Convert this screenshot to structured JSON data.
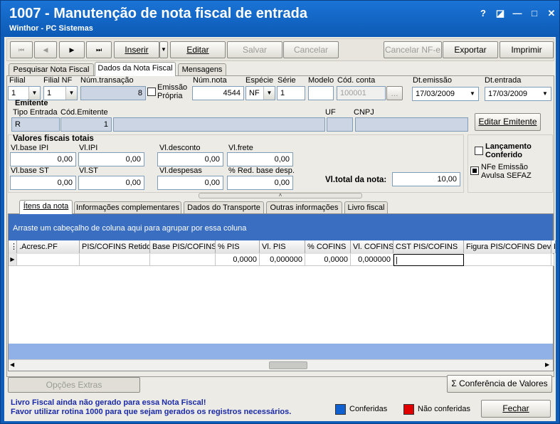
{
  "window": {
    "title": "1007 - Manutenção de nota fiscal de entrada",
    "subtitle": "Winthor - PC Sistemas",
    "help": "?",
    "restore": "◪",
    "min": "—",
    "max": "□",
    "close": "✕"
  },
  "toolbar": {
    "first": "⏮",
    "prev": "◀",
    "next": "▶",
    "last": "⏭",
    "inserir": "Inserir",
    "inserir_arrow": "▼",
    "editar": "Editar",
    "salvar": "Salvar",
    "cancelar": "Cancelar",
    "cancelar_nfe": "Cancelar NF-e",
    "exportar": "Exportar",
    "imprimir": "Imprimir"
  },
  "tabs": [
    "Pesquisar Nota Fiscal",
    "Dados da Nota Fiscal",
    "Mensagens"
  ],
  "form": {
    "filial": {
      "label": "Filial",
      "value": "1"
    },
    "filial_nf": {
      "label": "Filial NF",
      "value": "1"
    },
    "num_transacao": {
      "label": "Núm.transação",
      "value": "8"
    },
    "emissao_propria": {
      "label1": "Emissão",
      "label2": "Própria"
    },
    "num_nota": {
      "label": "Núm.nota",
      "value": "4544"
    },
    "especie": {
      "label": "Espécie",
      "value": "NF"
    },
    "serie": {
      "label": "Série",
      "value": "1"
    },
    "modelo": {
      "label": "Modelo",
      "value": ""
    },
    "cod_conta": {
      "label": "Cód. conta",
      "value": "100001",
      "btn": "..."
    },
    "dt_emissao": {
      "label": "Dt.emissão",
      "value": "17/03/2009"
    },
    "dt_entrada": {
      "label": "Dt.entrada",
      "value": "17/03/2009"
    }
  },
  "emitente": {
    "title": "Emitente",
    "tipo_label": "Tipo Entrada",
    "tipo_value": "R",
    "cod_label": "Cód.Emitente",
    "cod_value": "1",
    "uf_label": "UF",
    "cnpj_label": "CNPJ",
    "editar_btn": "Editar Emitente"
  },
  "valores": {
    "title": "Valores fiscais totais",
    "base_ipi": {
      "label": "Vl.base IPI",
      "value": "0,00"
    },
    "ipi": {
      "label": "Vl.IPI",
      "value": "0,00"
    },
    "desconto": {
      "label": "Vl.desconto",
      "value": "0,00"
    },
    "frete": {
      "label": "Vl.frete",
      "value": "0,00"
    },
    "base_st": {
      "label": "Vl.base ST",
      "value": "0,00"
    },
    "st": {
      "label": "Vl.ST",
      "value": "0,00"
    },
    "despesas": {
      "label": "Vl.despesas",
      "value": "0,00"
    },
    "red_base": {
      "label": "% Red. base desp.",
      "value": "0,00"
    },
    "total": {
      "label": "Vl.total da nota:",
      "value": "10,00"
    }
  },
  "lancamento": {
    "label1": "Lançamento",
    "label2": "Conferido",
    "nfe1": "NFe Emissão",
    "nfe2": "Avulsa SEFAZ"
  },
  "subtabs": [
    "Ítens da nota",
    "Informações complementares",
    "Dados do Transporte",
    "Outras informações",
    "Livro fiscal"
  ],
  "grid": {
    "group_hint": "Arraste um cabeçalho de coluna aqui para agrupar por essa coluna",
    "columns": [
      ".Acresc.PF",
      "PIS/COFINS Retido",
      "Base PIS/COFINS",
      "% PIS",
      "Vl. PIS",
      "% COFINS",
      "Vl. COFINS",
      "CST PIS/COFINS",
      "Figura PIS/COFINS Dev.",
      "P"
    ],
    "row": [
      "",
      "",
      "",
      "0,0000",
      "0,000000",
      "0,0000",
      "0,000000",
      "",
      "",
      ""
    ]
  },
  "bottom": {
    "opcoes": "Opções Extras",
    "conferencia": "Conferência de Valores",
    "sigma": "Σ"
  },
  "footer": {
    "msg1": "Livro Fiscal ainda não gerado para essa Nota Fiscal!",
    "msg2": "Favor utilizar rotina 1000 para que sejam gerados os registros necessários.",
    "legend_blue": "Conferidas",
    "legend_red": "Não conferidas",
    "fechar": "Fechar"
  },
  "colors": {
    "titlebar": "#0d5ab5",
    "grid_blue": "#3a6ec1",
    "legend_blue": "#1060d0",
    "legend_red": "#e00000"
  }
}
